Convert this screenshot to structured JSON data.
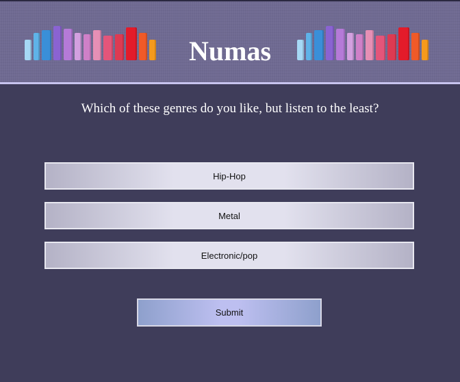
{
  "header": {
    "title": "Numas",
    "logo_icon": "equalizer-bars-icon",
    "bar_colors": [
      "#a6d8f5",
      "#5fb3e8",
      "#3a8fd8",
      "#8a63d2",
      "#b57ad8",
      "#d3a0e0",
      "#cf80c8",
      "#e68fb5",
      "#e4557a",
      "#dd3a52",
      "#e31b2a",
      "#f05a28",
      "#f59a1c"
    ]
  },
  "question": "Which of these genres do you like, but listen to the least?",
  "options": [
    "Hip-Hop",
    "Metal",
    "Electronic/pop"
  ],
  "submit_label": "Submit"
}
